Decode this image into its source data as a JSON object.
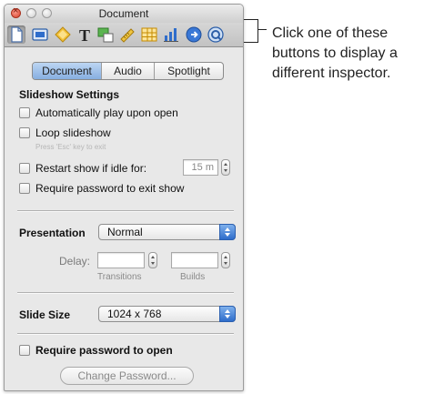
{
  "window": {
    "title": "Document"
  },
  "toolbar": {
    "buttons": [
      {
        "icon": "document-inspector-icon",
        "selected": true
      },
      {
        "icon": "slide-inspector-icon"
      },
      {
        "icon": "build-inspector-icon"
      },
      {
        "icon": "text-inspector-icon"
      },
      {
        "icon": "graphic-inspector-icon"
      },
      {
        "icon": "metrics-inspector-icon"
      },
      {
        "icon": "table-inspector-icon"
      },
      {
        "icon": "chart-inspector-icon"
      },
      {
        "icon": "hyperlink-inspector-icon"
      },
      {
        "icon": "quicktime-inspector-icon"
      }
    ]
  },
  "callout": {
    "lines": [
      "Click one of these",
      "buttons to display a",
      "different inspector."
    ]
  },
  "tabs": {
    "document": "Document",
    "audio": "Audio",
    "spotlight": "Spotlight",
    "active": "Document"
  },
  "slideshow": {
    "heading": "Slideshow Settings",
    "auto_play": "Automatically play upon open",
    "loop": "Loop slideshow",
    "loop_hint": "Press 'Esc' key to exit",
    "restart": "Restart show if idle for:",
    "restart_value": "15 m",
    "require_password_exit": "Require password to exit show"
  },
  "presentation": {
    "label": "Presentation",
    "value": "Normal",
    "delay_label": "Delay:",
    "transitions_label": "Transitions",
    "builds_label": "Builds"
  },
  "slide_size": {
    "label": "Slide Size",
    "value": "1024 x 768"
  },
  "security": {
    "require_password_open": "Require password to open",
    "change_password": "Change Password..."
  },
  "colors": {
    "accent": "#3a78d6",
    "panel": "#e8e8e8",
    "tab_active": "#9dc0ea"
  }
}
